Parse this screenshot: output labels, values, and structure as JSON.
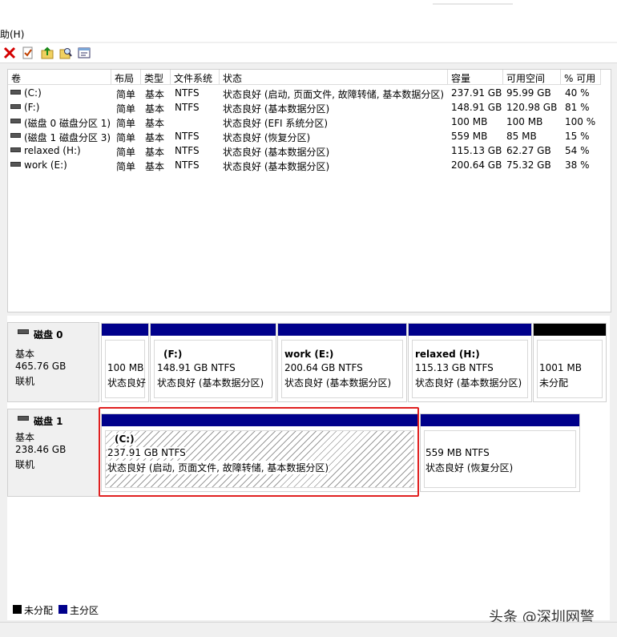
{
  "menu": {
    "help_label": "助(H)"
  },
  "columns": [
    "卷",
    "布局",
    "类型",
    "文件系统",
    "状态",
    "容量",
    "可用空间",
    "% 可用"
  ],
  "volumes": [
    {
      "name": "(C:)",
      "layout": "简单",
      "type": "基本",
      "fs": "NTFS",
      "status": "状态良好 (启动, 页面文件, 故障转储, 基本数据分区)",
      "capacity": "237.91 GB",
      "free": "95.99 GB",
      "pct": "40 %"
    },
    {
      "name": "(F:)",
      "layout": "简单",
      "type": "基本",
      "fs": "NTFS",
      "status": "状态良好 (基本数据分区)",
      "capacity": "148.91 GB",
      "free": "120.98 GB",
      "pct": "81 %"
    },
    {
      "name": "(磁盘 0 磁盘分区 1)",
      "layout": "简单",
      "type": "基本",
      "fs": "",
      "status": "状态良好 (EFI 系统分区)",
      "capacity": "100 MB",
      "free": "100 MB",
      "pct": "100 %"
    },
    {
      "name": "(磁盘 1 磁盘分区 3)",
      "layout": "简单",
      "type": "基本",
      "fs": "NTFS",
      "status": "状态良好 (恢复分区)",
      "capacity": "559 MB",
      "free": "85 MB",
      "pct": "15 %"
    },
    {
      "name": "relaxed (H:)",
      "layout": "简单",
      "type": "基本",
      "fs": "NTFS",
      "status": "状态良好 (基本数据分区)",
      "capacity": "115.13 GB",
      "free": "62.27 GB",
      "pct": "54 %"
    },
    {
      "name": "work (E:)",
      "layout": "简单",
      "type": "基本",
      "fs": "NTFS",
      "status": "状态良好 (基本数据分区)",
      "capacity": "200.64 GB",
      "free": "75.32 GB",
      "pct": "38 %"
    }
  ],
  "disks": [
    {
      "name": "磁盘 0",
      "type": "基本",
      "size": "465.76 GB",
      "state": "联机",
      "partitions": [
        {
          "title": "",
          "line1": "100 MB",
          "line2": "状态良好"
        },
        {
          "title": "(F:)",
          "line1": "148.91 GB NTFS",
          "line2": "状态良好 (基本数据分区)"
        },
        {
          "title": "work  (E:)",
          "line1": "200.64 GB NTFS",
          "line2": "状态良好 (基本数据分区)"
        },
        {
          "title": "relaxed  (H:)",
          "line1": "115.13 GB NTFS",
          "line2": "状态良好 (基本数据分区)"
        },
        {
          "title": "",
          "line1": "1001 MB",
          "line2": "未分配"
        }
      ]
    },
    {
      "name": "磁盘 1",
      "type": "基本",
      "size": "238.46 GB",
      "state": "联机",
      "partitions": [
        {
          "title": "(C:)",
          "line1": "237.91 GB NTFS",
          "line2": "状态良好 (启动, 页面文件, 故障转储, 基本数据分区)"
        },
        {
          "title": "",
          "line1": "559 MB NTFS",
          "line2": "状态良好 (恢复分区)"
        }
      ]
    }
  ],
  "legend": {
    "unallocated": "未分配",
    "primary": "主分区"
  },
  "colors": {
    "primary": "#00008b",
    "unallocated": "#000000",
    "highlight": "#e02020"
  },
  "watermark": "头条 @深圳网警"
}
